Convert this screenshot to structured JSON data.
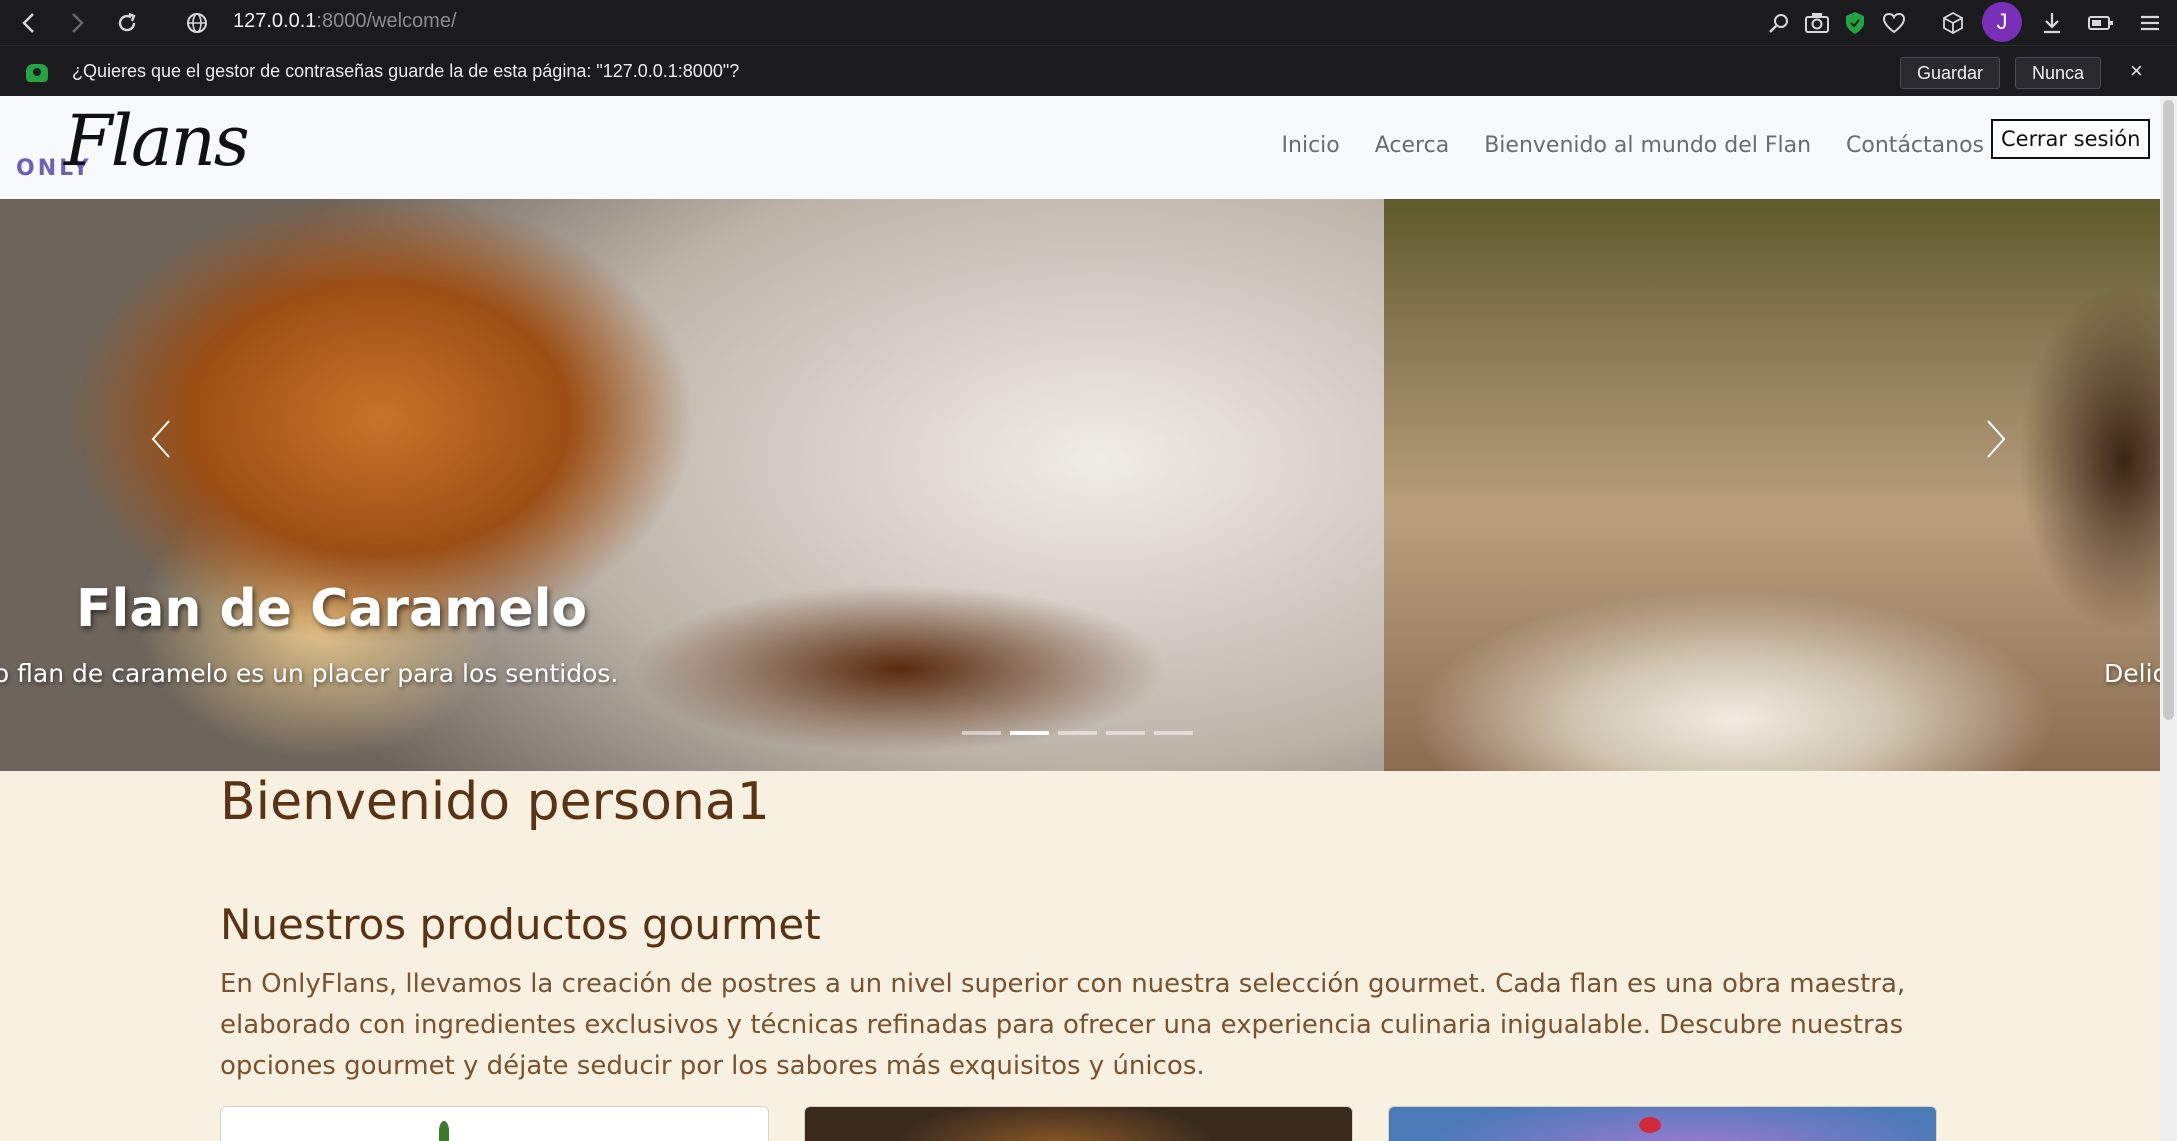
{
  "browser": {
    "url_host": "127.0.0.1",
    "url_path": ":8000/welcome/",
    "avatar_letter": "J"
  },
  "password_bar": {
    "prompt": "¿Quieres que el gestor de contraseñas guarde la de esta página: \"127.0.0.1:8000\"?",
    "save_label": "Guardar",
    "never_label": "Nunca",
    "close_symbol": "×"
  },
  "navbar": {
    "logo_only": "ONLY",
    "logo_flans": "Flans",
    "links": [
      "Inicio",
      "Acerca",
      "Bienvenido al mundo del Flan",
      "Contáctanos"
    ],
    "logout_label": "Cerrar sesión"
  },
  "carousel": {
    "slide_title": "Flan de Caramelo",
    "slide_text": "estro flan de caramelo es un placer para los sentidos.",
    "next_slide_text_fragment": "Delic",
    "indicator_count": 5,
    "active_indicator": 1
  },
  "main": {
    "welcome": "Bienvenido persona1",
    "section_title": "Nuestros productos gourmet",
    "section_text": "En OnlyFlans, llevamos la creación de postres a un nivel superior con nuestra selección gourmet. Cada flan es una obra maestra, elaborado con ingredientes exclusivos y técnicas refinadas para ofrecer una experiencia culinaria inigualable. Descubre nuestras opciones gourmet y déjate seducir por los sabores más exquisitos y únicos."
  },
  "colors": {
    "page_bg": "#f8f0e0",
    "heading": "#5a3214",
    "text": "#7a5230",
    "logo_accent": "#6a63b8",
    "avatar": "#7a2fb8"
  }
}
